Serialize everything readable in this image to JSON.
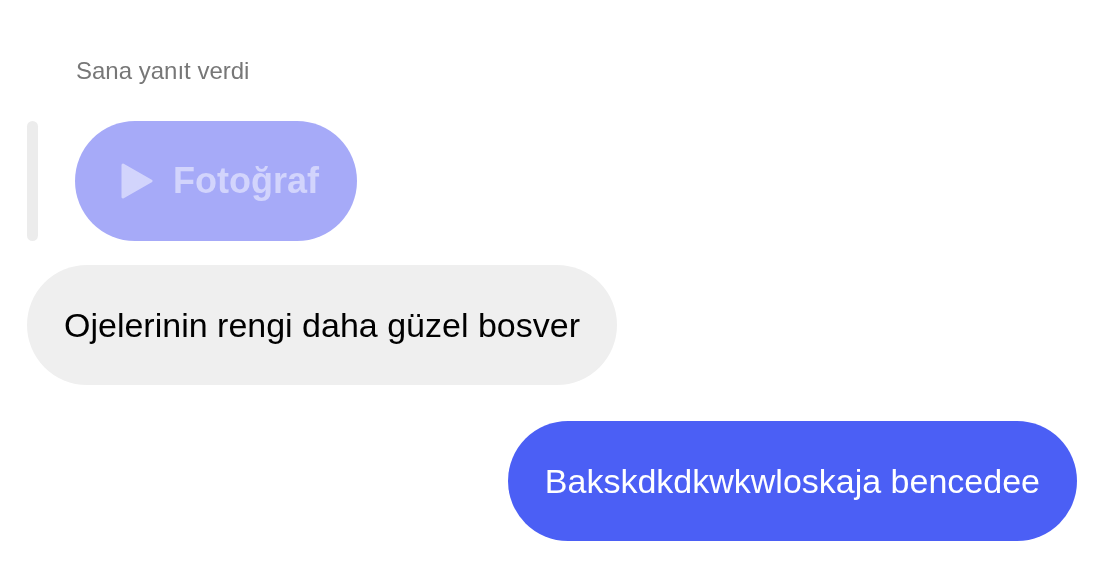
{
  "reply_label": "Sana yanıt verdi",
  "quoted_message": {
    "kind": "photo",
    "label": "Fotoğraf"
  },
  "messages": [
    {
      "kind": "received",
      "text": "Ojelerinin rengi daha güzel bosver"
    },
    {
      "kind": "sent",
      "text": "Bakskdkdkwkwloskaja bencedee"
    }
  ]
}
